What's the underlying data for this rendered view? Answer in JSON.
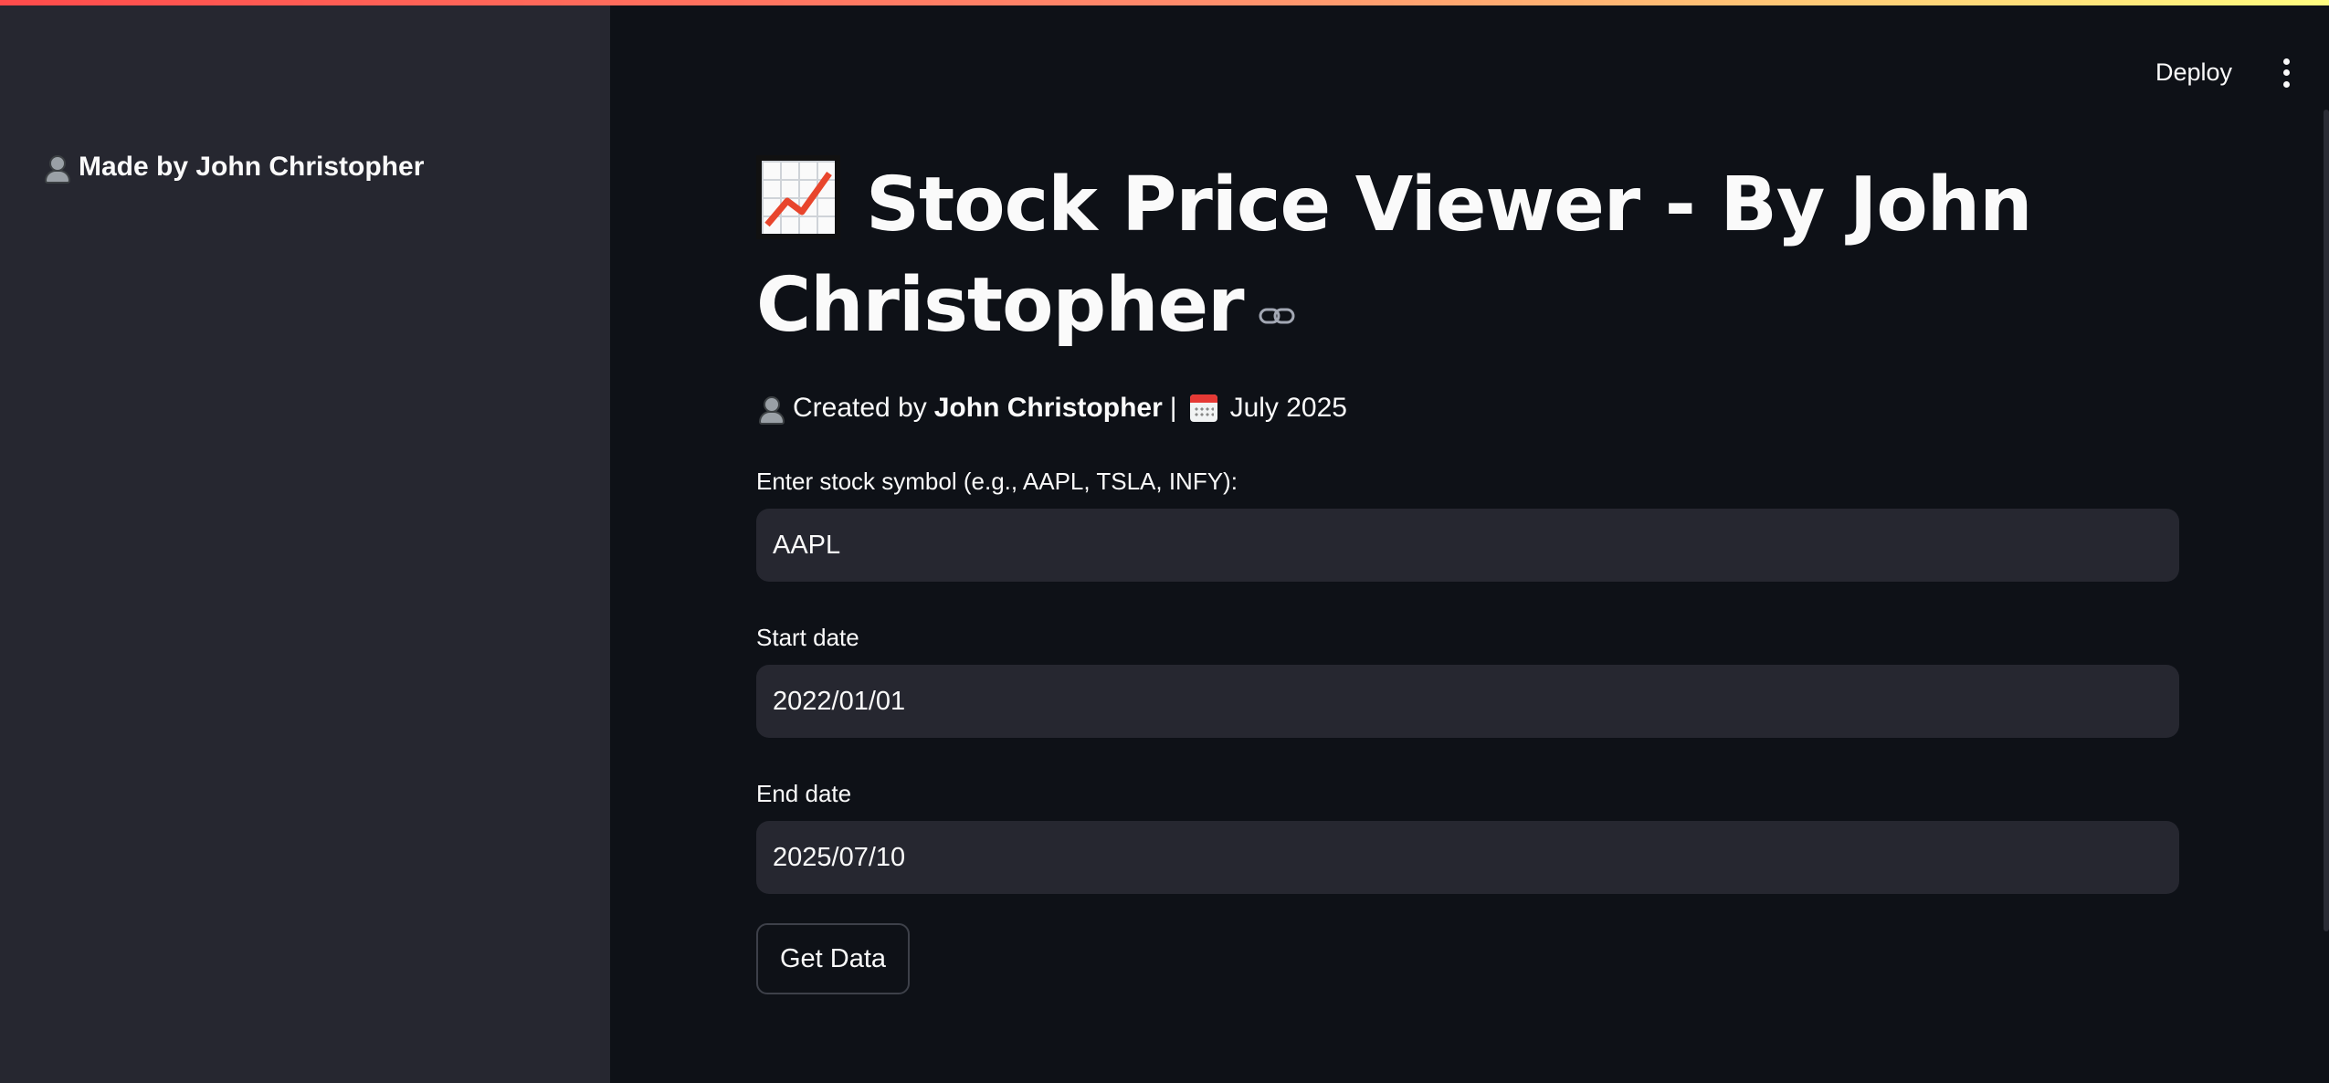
{
  "sidebar": {
    "credit": "Made by John Christopher"
  },
  "toolbar": {
    "deploy_label": "Deploy"
  },
  "main": {
    "title": "Stock Price Viewer - By John Christopher",
    "caption": {
      "prefix": "Created by",
      "author": "John Christopher",
      "separator": "|",
      "date": "July 2025"
    },
    "fields": {
      "symbol": {
        "label": "Enter stock symbol (e.g., AAPL, TSLA, INFY):",
        "value": "AAPL"
      },
      "start_date": {
        "label": "Start date",
        "value": "2022/01/01"
      },
      "end_date": {
        "label": "End date",
        "value": "2025/07/10"
      }
    },
    "get_data_label": "Get Data"
  },
  "colors": {
    "background": "#0e1117",
    "sidebar": "#262730",
    "input": "#262730",
    "accent_gradient_start": "#ff4b4b",
    "accent_gradient_end": "#fffd80"
  },
  "icons": [
    "person-emoji-icon",
    "chart-increasing-emoji-icon",
    "link-icon",
    "calendar-emoji-icon",
    "more-vertical-icon"
  ]
}
